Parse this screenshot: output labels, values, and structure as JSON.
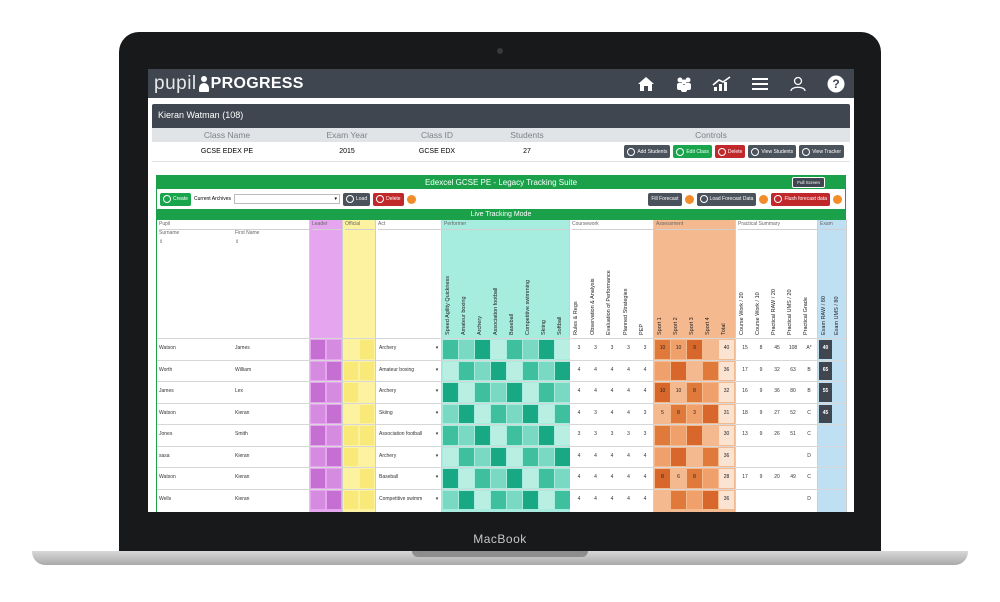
{
  "device": {
    "brand": "MacBook"
  },
  "app": {
    "logo_left": "pupil",
    "logo_right": "PROGRESS",
    "nav_icons": [
      "home-icon",
      "group-icon",
      "chart-icon",
      "menu-icon",
      "user-icon",
      "help-icon"
    ]
  },
  "student_header": "Kieran Watman (108)",
  "class_table": {
    "headers": [
      "Class Name",
      "Exam Year",
      "Class ID",
      "Students",
      "Controls"
    ],
    "row": {
      "class_name": "GCSE EDEX PE",
      "exam_year": "2015",
      "class_id": "GCSE EDX",
      "students": "27"
    },
    "controls": [
      "Add Students",
      "Edit Class",
      "Delete",
      "View Students",
      "View Tracker"
    ]
  },
  "suite": {
    "title": "Edexcel GCSE PE - Legacy Tracking Suite",
    "full_screen": "Full Screen",
    "create": "Create",
    "archives_label": "Current Archives",
    "load": "Load",
    "delete": "Delete",
    "fill_forecast": "Fill Forecast",
    "load_forecast": "Load Forecast Data",
    "flush_forecast": "Flush forecast data",
    "mode": "Live Tracking Mode"
  },
  "groups": [
    "Pupil",
    "Leader",
    "Official",
    "Act",
    "Performer",
    "Coursework",
    "Assessment",
    "Practical Summary",
    "Exam"
  ],
  "subheaders": {
    "surname": "Surname",
    "first": "First Name"
  },
  "columns": {
    "performer": [
      "Speed Agility Quickness",
      "Amateur boxing",
      "Archery",
      "Association football",
      "Baseball",
      "Competitive swimming",
      "Skiing",
      "Softball"
    ],
    "coursework": [
      "Rules & Regs",
      "Observation & Analysis",
      "Evaluation of Performance",
      "Planned Strategies",
      "PEP"
    ],
    "assessment": [
      "Sport 1",
      "Sport 2",
      "Sport 3",
      "Sport 4",
      "Total"
    ],
    "practical": [
      "Course Work / 20",
      "Course Work / 10",
      "Practical RAW / 20",
      "Practical UMS / 20",
      "Practical Grade"
    ],
    "exam": [
      "Exam RAW / 80",
      "Exam UMS / 80"
    ]
  },
  "colors": {
    "leader": "#e6a6ef",
    "official": "#fdf2a0",
    "performer": "#a6ecdf",
    "assessment": "#f5b990",
    "exam": "#bfe0f2",
    "green": "#1aa14a",
    "appbar": "#3f4650"
  },
  "students": [
    {
      "surname": "Watson",
      "first": "James",
      "act": "Archery",
      "cw": [
        "3",
        "3",
        "3",
        "3",
        "3"
      ],
      "asmt": [
        "10",
        "10",
        "9",
        "",
        "40"
      ],
      "prac": [
        "15",
        "8",
        "45",
        "108",
        "A*"
      ],
      "exam": "40"
    },
    {
      "surname": "Worth",
      "first": "William",
      "act": "Amateur boxing",
      "cw": [
        "4",
        "4",
        "4",
        "4",
        "4"
      ],
      "asmt": [
        "",
        "",
        "",
        "",
        "36"
      ],
      "prac": [
        "17",
        "9",
        "32",
        "63",
        "B"
      ],
      "exam": "65"
    },
    {
      "surname": "James",
      "first": "Lex",
      "act": "Archery",
      "cw": [
        "4",
        "4",
        "4",
        "4",
        "4"
      ],
      "asmt": [
        "10",
        "10",
        "8",
        "",
        "32"
      ],
      "prac": [
        "16",
        "9",
        "36",
        "80",
        "B"
      ],
      "exam": "55"
    },
    {
      "surname": "Watson",
      "first": "Kieran",
      "act": "Skiing",
      "cw": [
        "4",
        "3",
        "4",
        "4",
        "3"
      ],
      "asmt": [
        "5",
        "8",
        "3",
        "",
        "31"
      ],
      "prac": [
        "18",
        "9",
        "27",
        "52",
        "C"
      ],
      "exam": "45"
    },
    {
      "surname": "Jones",
      "first": "Smith",
      "act": "Association football",
      "cw": [
        "3",
        "3",
        "3",
        "3",
        "3"
      ],
      "asmt": [
        "",
        "",
        "",
        "",
        "30"
      ],
      "prac": [
        "13",
        "9",
        "26",
        "51",
        "C"
      ],
      "exam": ""
    },
    {
      "surname": "sasa",
      "first": "Kieran",
      "act": "Archery",
      "cw": [
        "4",
        "4",
        "4",
        "4",
        "4"
      ],
      "asmt": [
        "",
        "",
        "",
        "",
        "36"
      ],
      "prac": [
        "",
        "",
        "",
        "",
        "D"
      ],
      "exam": ""
    },
    {
      "surname": "Watson",
      "first": "Kieran",
      "act": "Baseball",
      "cw": [
        "4",
        "4",
        "4",
        "4",
        "4"
      ],
      "asmt": [
        "8",
        "6",
        "8",
        "",
        "28"
      ],
      "prac": [
        "17",
        "9",
        "20",
        "49",
        "C"
      ],
      "exam": ""
    },
    {
      "surname": "Wells",
      "first": "Kieran",
      "act": "Competitive swimm",
      "cw": [
        "4",
        "4",
        "4",
        "4",
        "4"
      ],
      "asmt": [
        "",
        "",
        "",
        "",
        "36"
      ],
      "prac": [
        "",
        "",
        "",
        "",
        "D"
      ],
      "exam": ""
    }
  ]
}
